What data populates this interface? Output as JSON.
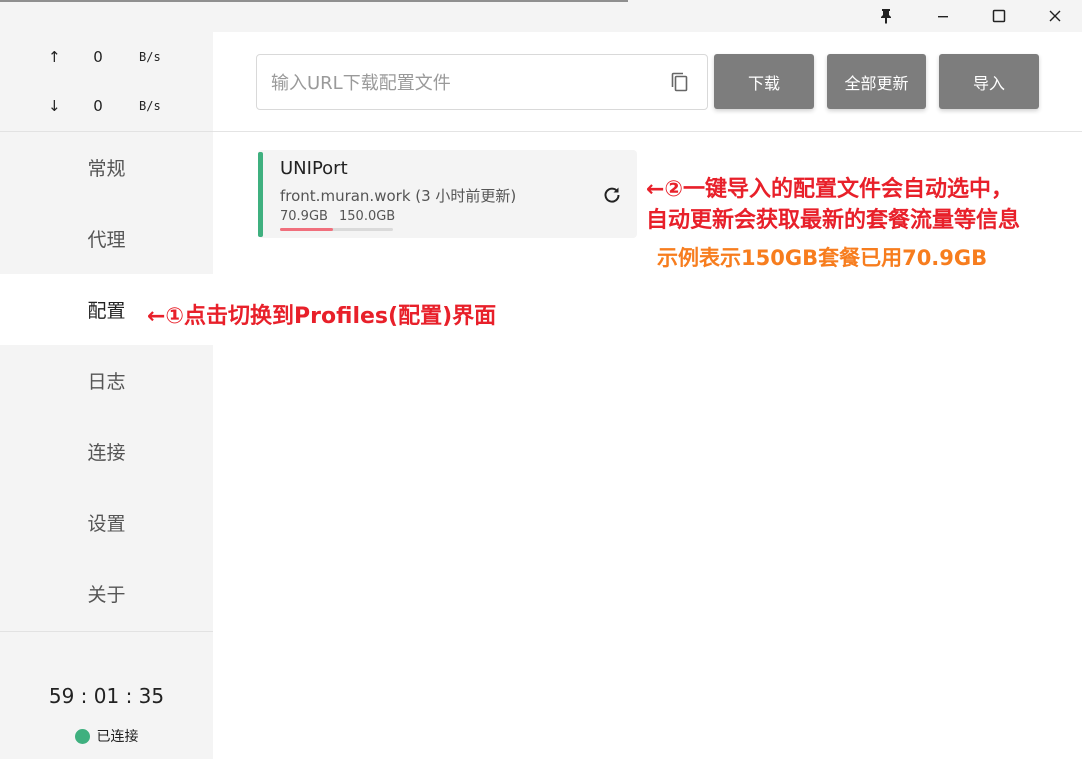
{
  "window": {
    "controls": [
      "pin-icon",
      "minimize-icon",
      "maximize-icon",
      "close-icon"
    ]
  },
  "traffic": {
    "upload_arrow": "↑",
    "upload_value": "0",
    "upload_unit": "B/s",
    "download_arrow": "↓",
    "download_value": "0",
    "download_unit": "B/s"
  },
  "sidebar": {
    "items": [
      {
        "label": "常规"
      },
      {
        "label": "代理"
      },
      {
        "label": "配置"
      },
      {
        "label": "日志"
      },
      {
        "label": "连接"
      },
      {
        "label": "设置"
      },
      {
        "label": "关于"
      }
    ],
    "active_index": 2,
    "timer": "59 : 01 : 35",
    "status": "已连接",
    "status_color": "#3fb07f"
  },
  "toolbar": {
    "url_placeholder": "输入URL下载配置文件",
    "url_value": "",
    "download_label": "下载",
    "update_all_label": "全部更新",
    "import_label": "导入"
  },
  "profile": {
    "name": "UNIPort",
    "url": "front.muran.work (3 小时前更新)",
    "used": "70.9GB",
    "total": "150.0GB",
    "usage_fraction": 0.47,
    "accent_color": "#3fb07f",
    "usage_color": "#f06f7c"
  },
  "annotations": {
    "a1": "←①点击切换到Profiles(配置)界面",
    "a2_line1": "←②一键导入的配置文件会自动选中，",
    "a2_line2": "自动更新会获取最新的套餐流量等信息",
    "a3": "示例表示150GB套餐已用70.9GB",
    "red_color": "#e8202a",
    "orange_color": "#f77d1e"
  }
}
